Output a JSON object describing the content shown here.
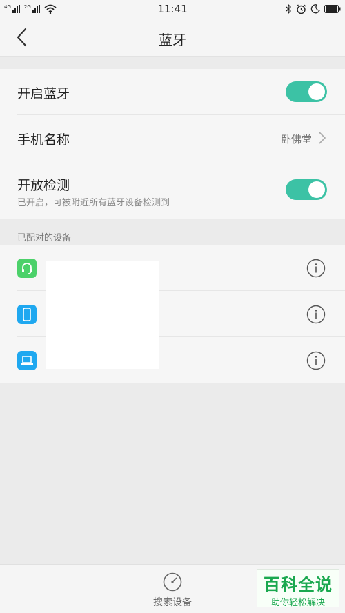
{
  "status_bar": {
    "time": "11:41",
    "net1": "4G",
    "net2": "2G"
  },
  "header": {
    "title": "蓝牙"
  },
  "settings": {
    "bluetooth_label": "开启蓝牙",
    "bluetooth_on": true,
    "phone_name_label": "手机名称",
    "phone_name_value": "卧佛堂",
    "discoverable_label": "开放检测",
    "discoverable_sub": "已开启，可被附近所有蓝牙设备检测到",
    "discoverable_on": true
  },
  "paired": {
    "section_label": "已配对的设备",
    "devices": [
      {
        "icon": "headset-icon",
        "color": "#4cd16a"
      },
      {
        "icon": "phone-icon",
        "color": "#1fa8f0"
      },
      {
        "icon": "laptop-icon",
        "color": "#1fa8f0"
      }
    ]
  },
  "bottom": {
    "search_label": "搜索设备"
  },
  "watermark": {
    "main": "百科全说",
    "sub": "助你轻松解决"
  },
  "colors": {
    "toggle_on": "#3cc2a5",
    "accent_green": "#4cd16a",
    "accent_blue": "#1fa8f0"
  }
}
